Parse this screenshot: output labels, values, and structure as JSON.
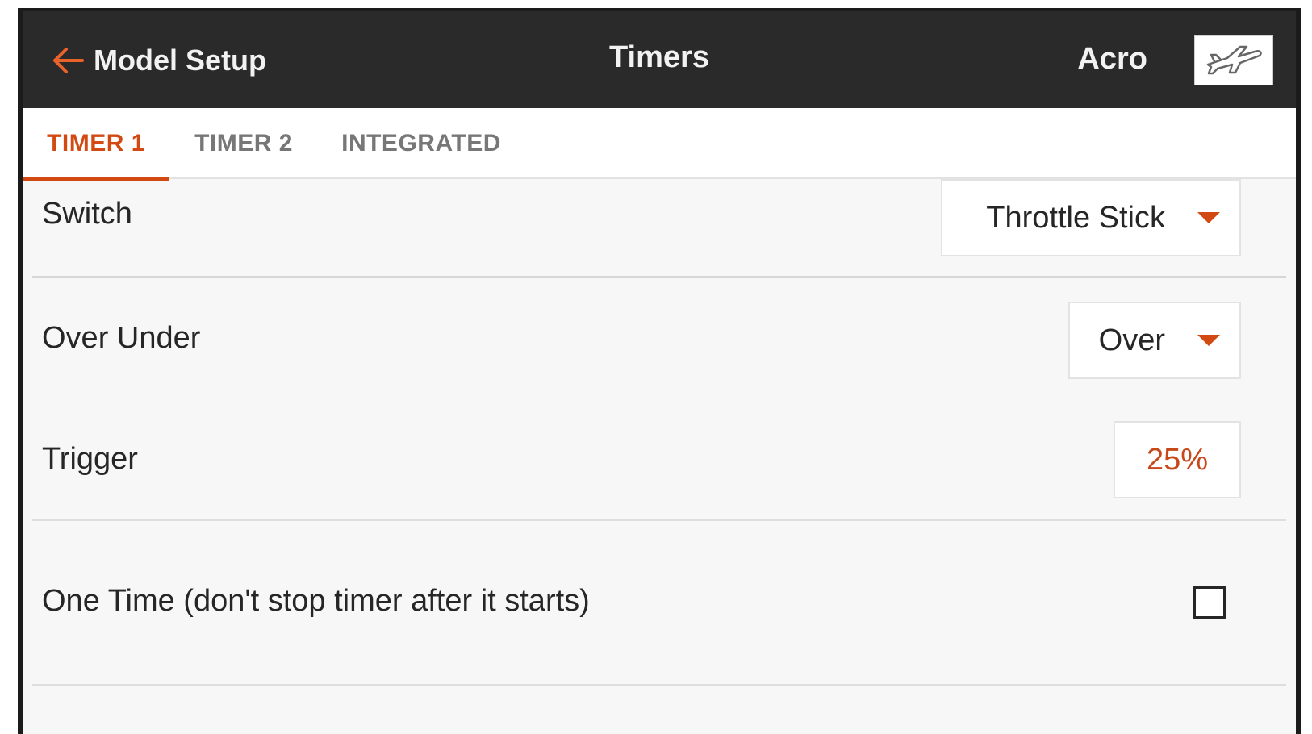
{
  "header": {
    "back_label": "Model Setup",
    "title": "Timers",
    "model_name": "Acro",
    "model_icon": "airplane-icon"
  },
  "tabs": [
    {
      "label": "TIMER 1",
      "active": true
    },
    {
      "label": "TIMER 2",
      "active": false
    },
    {
      "label": "INTEGRATED",
      "active": false
    }
  ],
  "rows": {
    "switch": {
      "label": "Switch",
      "value": "Throttle Stick"
    },
    "over_under": {
      "label": "Over Under",
      "value": "Over"
    },
    "trigger": {
      "label": "Trigger",
      "value": "25%"
    },
    "one_time": {
      "label": "One Time (don't stop timer after it starts)",
      "checked": false
    }
  },
  "colors": {
    "accent": "#d24a12",
    "header_bg": "#2a2a2a",
    "content_bg": "#f7f7f7"
  }
}
